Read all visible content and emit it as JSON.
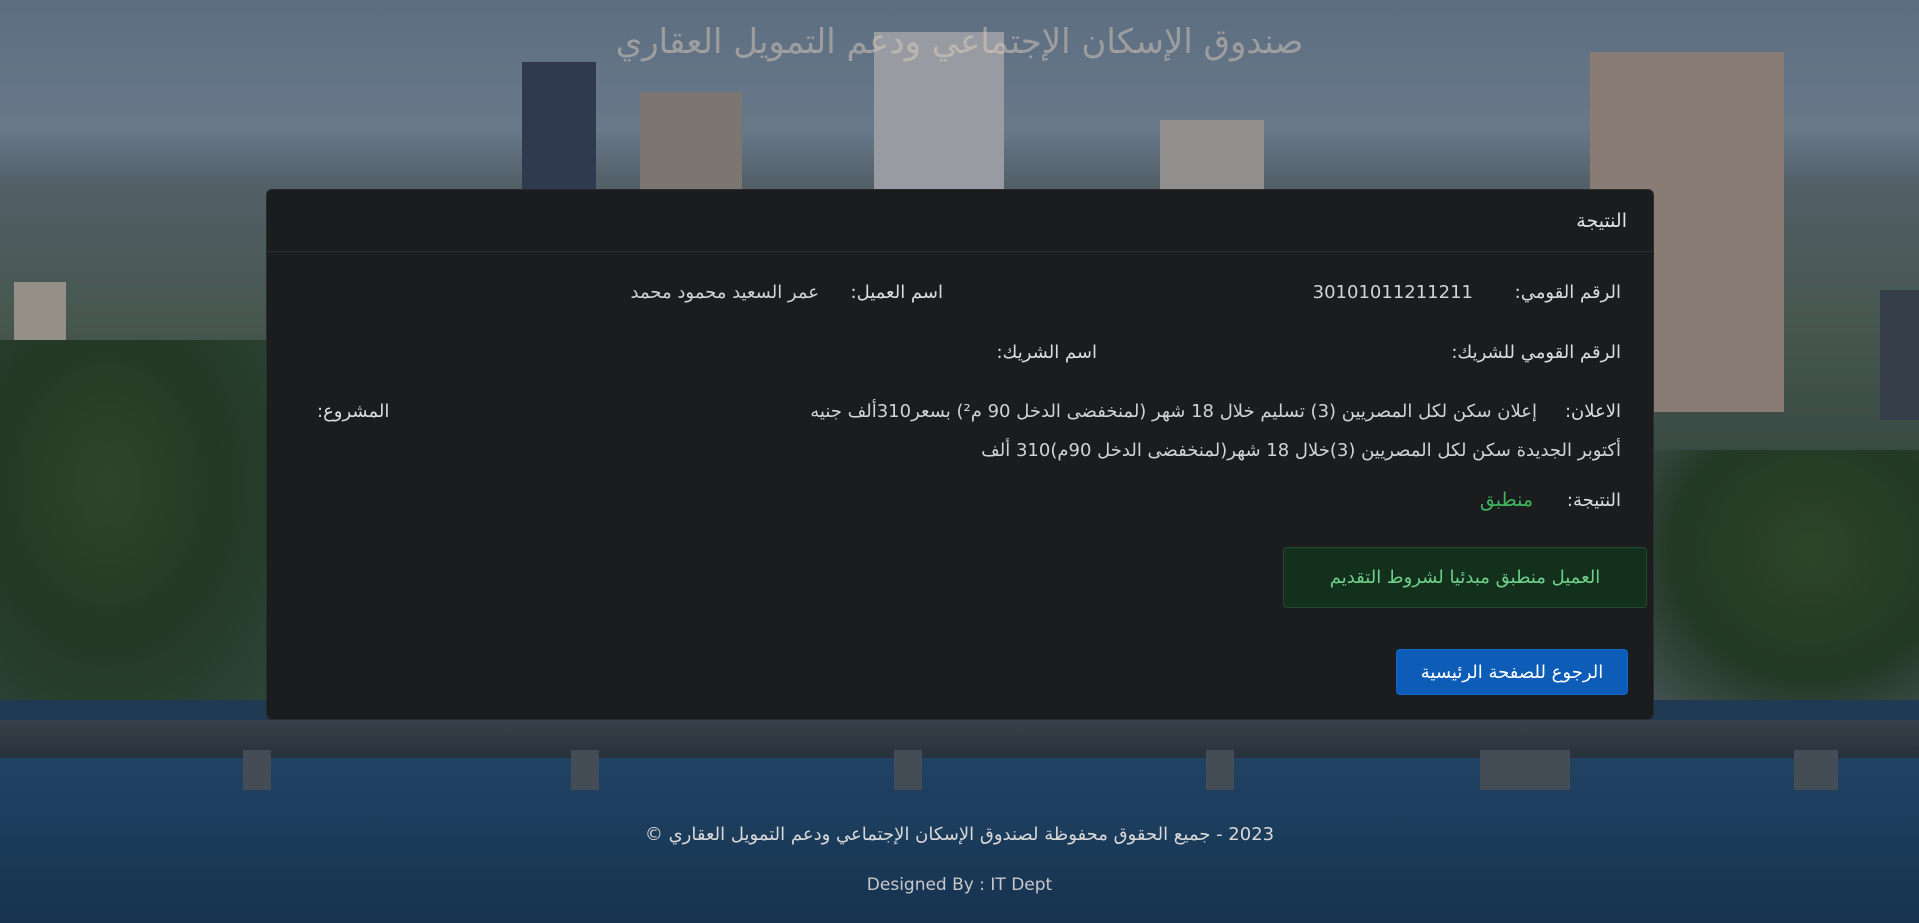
{
  "site": {
    "title": "صندوق الإسكان الإجتماعي ودعم التمويل العقاري"
  },
  "card": {
    "header": "النتيجة",
    "national_id_label": "الرقم القومي:",
    "national_id_value": "30101011211211",
    "client_name_label": "اسم العميل:",
    "client_name_value": "عمر السعيد محمود محمد",
    "partner_id_label": "الرقم القومي للشريك:",
    "partner_id_value": "",
    "partner_name_label": "اسم الشريك:",
    "partner_name_value": "",
    "announcement_label": "الاعلان:",
    "announcement_value": "إعلان سكن لكل المصريين (3) تسليم خلال 18 شهر (لمنخفضى الدخل 90 م²) بسعر310ألف جنيه",
    "project_label": "المشروع:",
    "project_value": "أكتوبر الجديدة سكن لكل المصريين (3)خلال 18 شهر(لمنخفضى الدخل 90م)310 ألف",
    "result_label": "النتيجة:",
    "result_value": "منطبق",
    "alert_text": "العميل منطبق مبدئيا لشروط التقديم",
    "back_button": "الرجوع للصفحة الرئيسية"
  },
  "footer": {
    "copyright": "2023 - جميع الحقوق محفوظة لصندوق الإسكان الإجتماعي ودعم التمويل العقاري ©",
    "designed_by": "Designed By : IT Dept"
  },
  "colors": {
    "card_bg": "#1b1c1e",
    "success": "#3fb55f",
    "alert_bg": "#13301d",
    "button_bg": "#0d5cb8"
  }
}
